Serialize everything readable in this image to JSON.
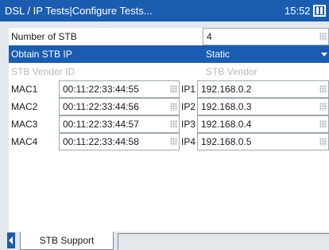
{
  "titlebar": {
    "title": "DSL / IP Tests|Configure Tests...",
    "time": "15:52"
  },
  "rows": {
    "num_stb": {
      "label": "Number of STB",
      "value": "4"
    },
    "obtain_ip": {
      "label": "Obtain STB IP",
      "value": "Static"
    },
    "vendor": {
      "label": "STB Vender ID",
      "value": "STB Vendor"
    }
  },
  "stb": [
    {
      "mac_label": "MAC1",
      "mac": "00:11:22:33:44:55",
      "ip_label": "IP1",
      "ip": "192.168.0.2"
    },
    {
      "mac_label": "MAC2",
      "mac": "00:11:22:33:44:56",
      "ip_label": "IP2",
      "ip": "192.168.0.3"
    },
    {
      "mac_label": "MAC3",
      "mac": "00:11:22:33:44:57",
      "ip_label": "IP3",
      "ip": "192.168.0.4"
    },
    {
      "mac_label": "MAC4",
      "mac": "00:11:22:33:44:58",
      "ip_label": "IP4",
      "ip": "192.168.0.5"
    }
  ],
  "tabs": {
    "active": "STB Support"
  },
  "colors": {
    "accent": "#1a5db0",
    "disabled_text": "#b7b7b7",
    "background": "#e3e8ec"
  },
  "icons": {
    "battery": "battery-icon",
    "grip": "keypad-grip-icon",
    "dropdown": "chevron-down-icon",
    "tab_scroll": "scroll-left-icon"
  }
}
